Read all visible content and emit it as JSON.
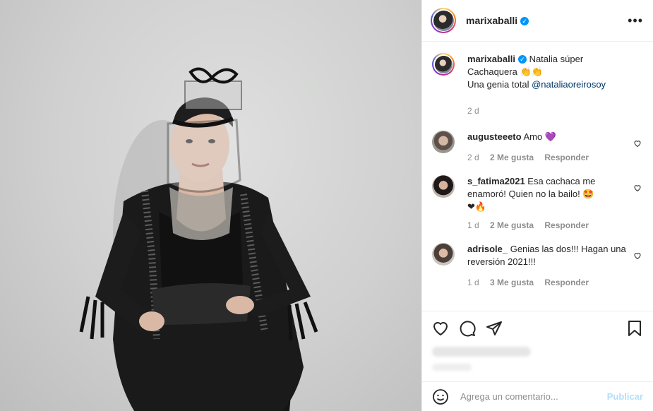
{
  "post": {
    "username": "marixaballi",
    "verified_mark": "✓",
    "more_icon": "more-options-icon",
    "caption": {
      "username": "marixaballi",
      "line1": "Natalia súper",
      "line2": "Cachaquera 👏👏",
      "line3_prefix": "Una genia total ",
      "mention": "@nataliaoreirosoy",
      "time": "2 d"
    }
  },
  "comments": [
    {
      "username": "augusteeeto",
      "text": "Amo 💜",
      "time": "2 d",
      "likes": "2 Me gusta",
      "reply": "Responder"
    },
    {
      "username": "s_fatima2021",
      "text": "Esa cachaca me enamoró! Quien no la bailo! 🤩",
      "text_extra": "❤🔥",
      "time": "1 d",
      "likes": "2 Me gusta",
      "reply": "Responder"
    },
    {
      "username": "adrisole_",
      "text": "Genias las dos!!! Hagan una reversión 2021!!!",
      "time": "1 d",
      "likes": "3 Me gusta",
      "reply": "Responder"
    }
  ],
  "actions": {
    "like_icon": "heart-icon",
    "comment_icon": "comment-icon",
    "share_icon": "share-icon",
    "save_icon": "bookmark-icon"
  },
  "add_comment": {
    "placeholder": "Agrega un comentario...",
    "publish_label": "Publicar",
    "emoji_icon": "emoji-icon"
  }
}
